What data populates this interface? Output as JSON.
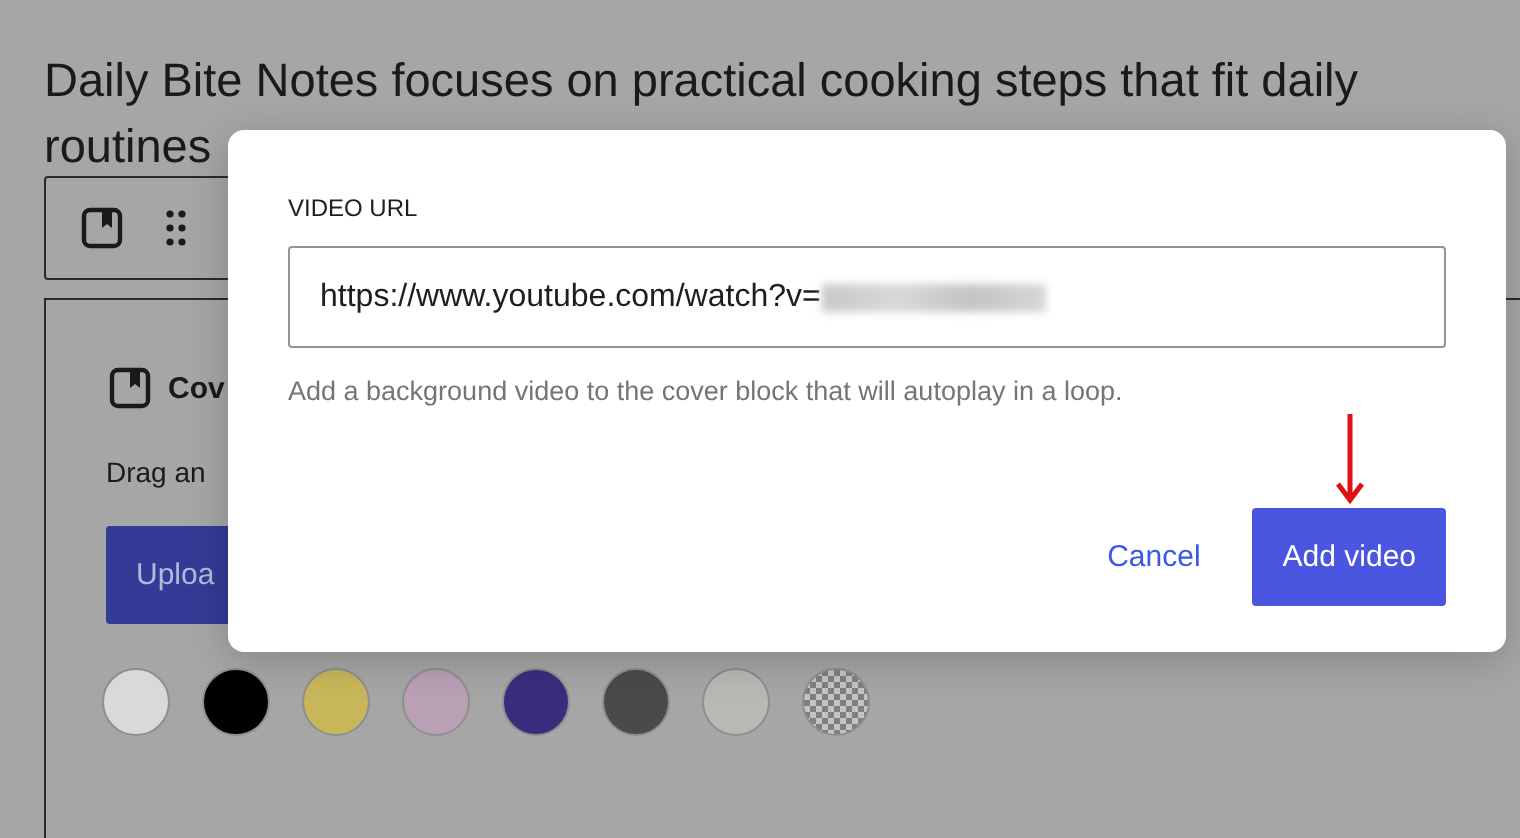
{
  "page": {
    "intro_line_1": "Daily Bite Notes focuses on practical cooking steps that fit daily",
    "intro_line_2": "routines"
  },
  "block": {
    "title": "Cov",
    "hint": "Drag an",
    "upload": "Uploa",
    "swatches": [
      {
        "color": "#d9d9d9",
        "kind": "plain"
      },
      {
        "color": "#000000",
        "kind": "plain"
      },
      {
        "color": "#c8b65a",
        "kind": "plain"
      },
      {
        "color": "#b9a0b5",
        "kind": "plain"
      },
      {
        "color": "#3a2d7e",
        "kind": "plain"
      },
      {
        "color": "#4a4a4a",
        "kind": "plain"
      },
      {
        "color": "#b8b8b4",
        "kind": "plain"
      },
      {
        "color": "#808080",
        "kind": "checker"
      }
    ]
  },
  "dialog": {
    "label": "VIDEO URL",
    "value": "https://www.youtube.com/watch?v=",
    "value_blurred": true,
    "help": "Add a background video to the cover block that will autoplay in a loop.",
    "cancel": "Cancel",
    "confirm": "Add video",
    "pointer_arrow": true
  }
}
